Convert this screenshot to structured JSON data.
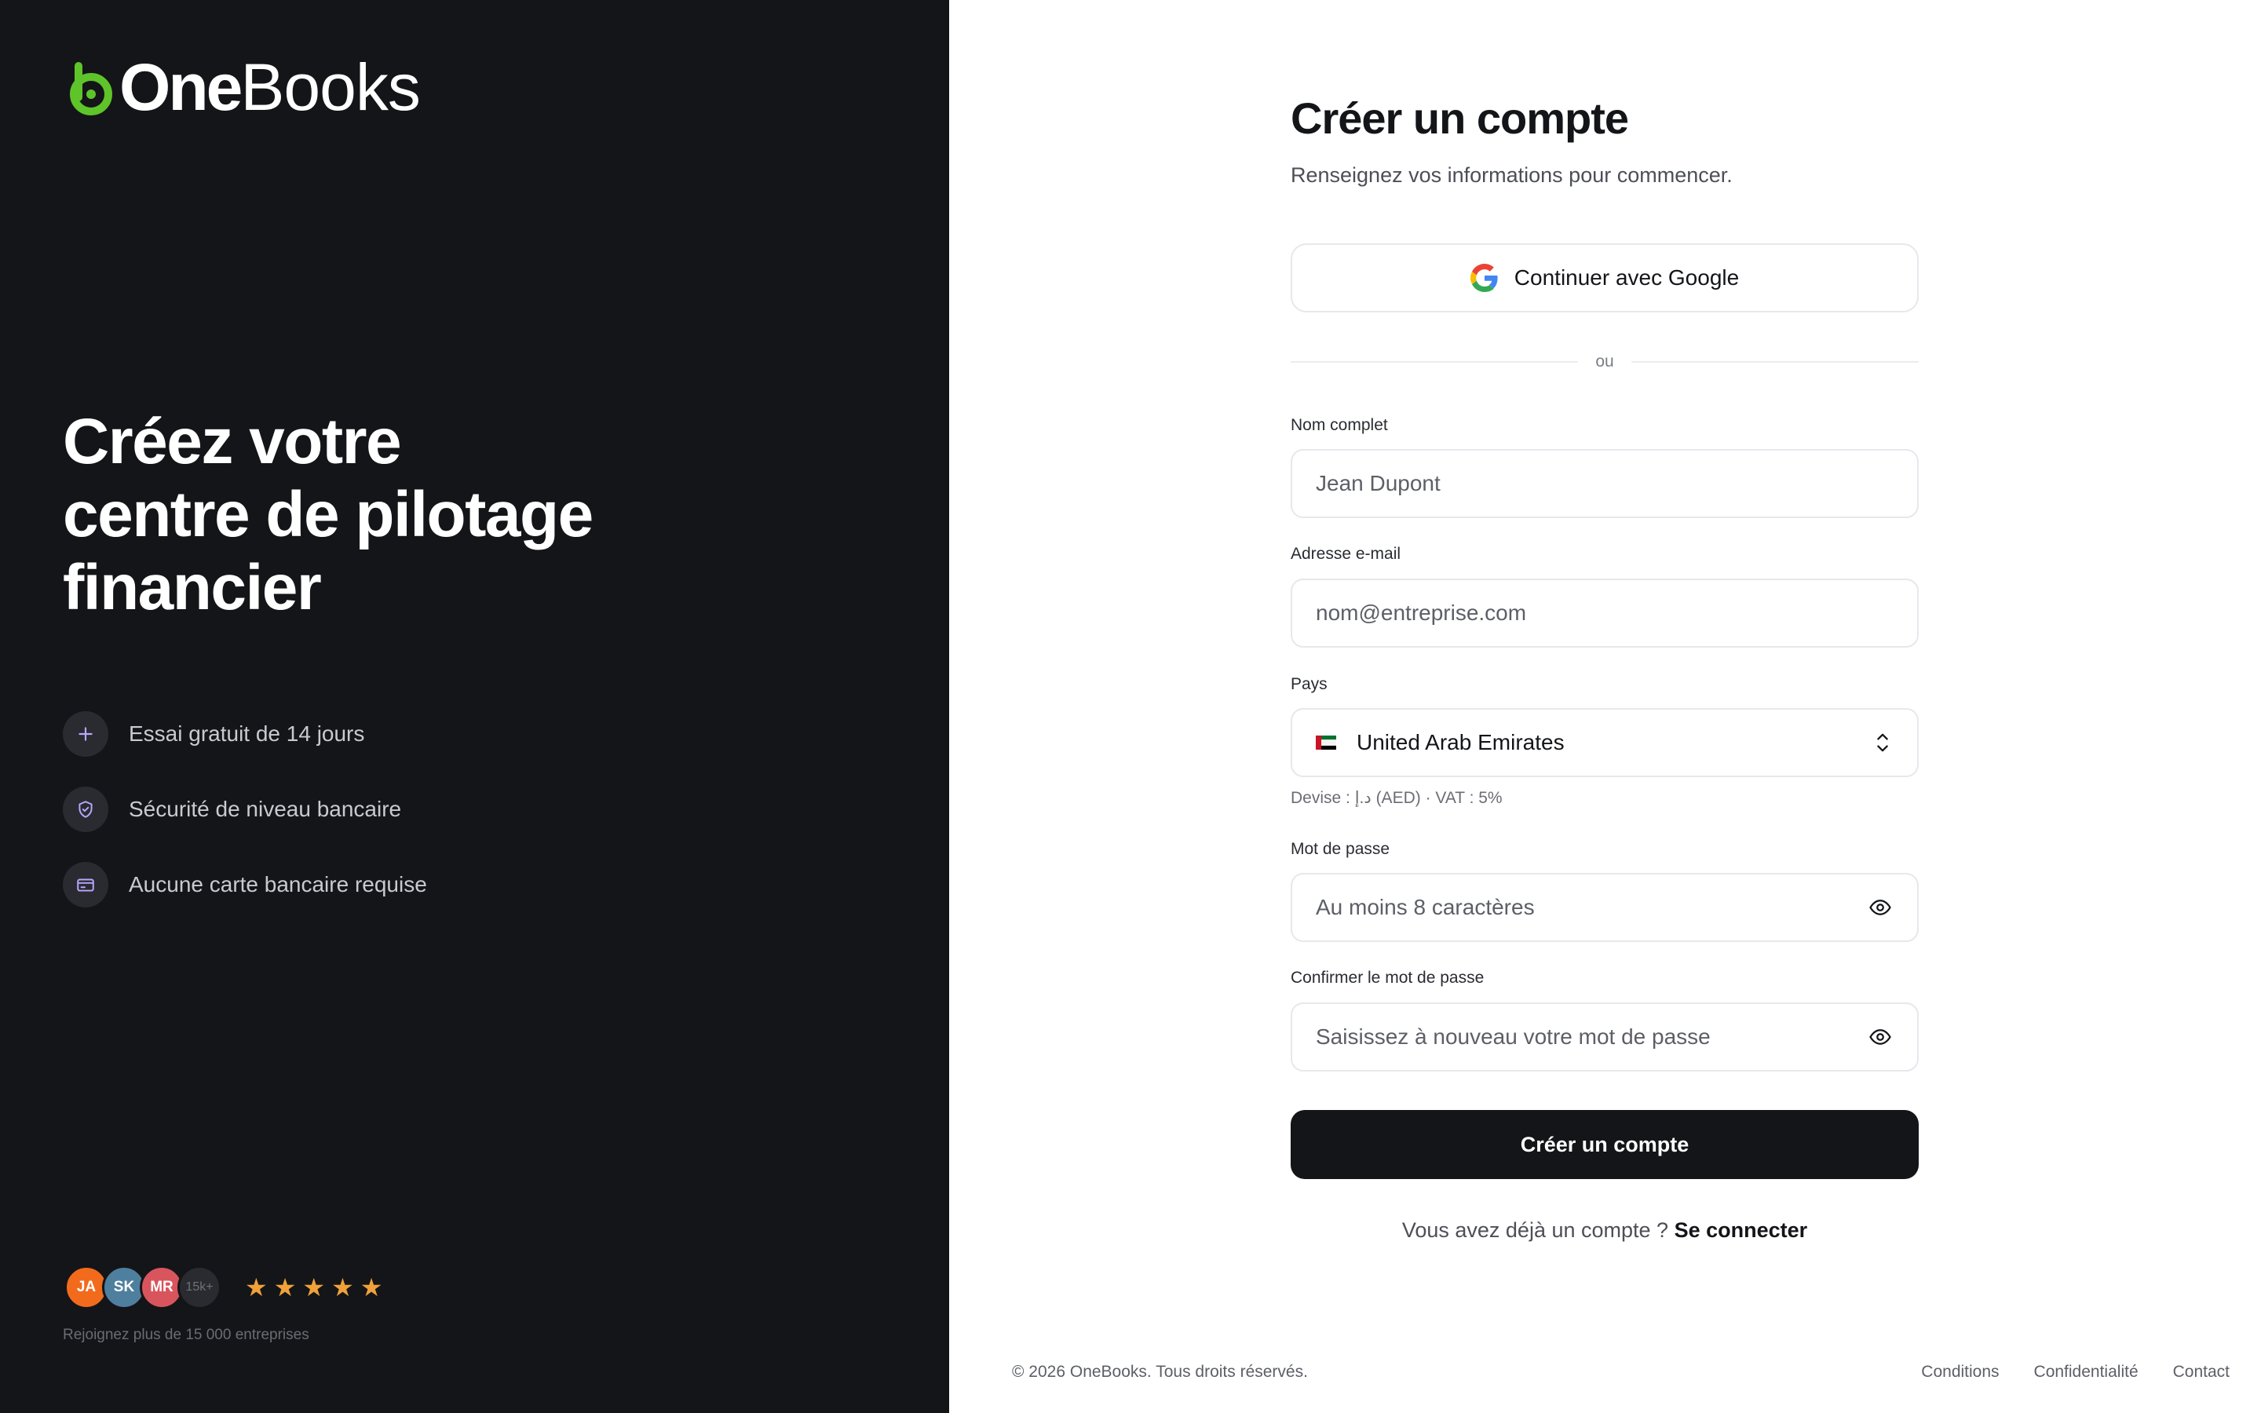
{
  "brand": {
    "name_part1": "One",
    "name_part2": "Books",
    "accent": "#5ec42a",
    "logo_icon": "onebooks-logo-icon"
  },
  "hero": {
    "line1": "Créez votre",
    "line2": "centre de pilotage",
    "line3": "financier"
  },
  "features": [
    {
      "icon": "plus-icon",
      "label": "Essai gratuit de 14 jours"
    },
    {
      "icon": "shield-check-icon",
      "label": "Sécurité de niveau bancaire"
    },
    {
      "icon": "credit-card-icon",
      "label": "Aucune carte bancaire requise"
    }
  ],
  "social": {
    "avatars": [
      {
        "initials": "JA",
        "color": "#f26b1d"
      },
      {
        "initials": "SK",
        "color": "#4f7f9e"
      },
      {
        "initials": "MR",
        "color": "#d9555d"
      },
      {
        "initials": "15k+",
        "color": "#2a2b30"
      }
    ],
    "rating_stars": 5,
    "stars": "★★★★★",
    "caption": "Rejoignez plus de 15 000 entreprises"
  },
  "form": {
    "title": "Créer un compte",
    "subtitle": "Renseignez vos informations pour commencer.",
    "google_label": "Continuer avec Google",
    "divider": "ou",
    "full_name": {
      "label": "Nom complet",
      "placeholder": "Jean Dupont"
    },
    "email": {
      "label": "Adresse e-mail",
      "placeholder": "nom@entreprise.com"
    },
    "country": {
      "label": "Pays",
      "value": "United Arab Emirates",
      "hint": "Devise : د.إ (AED) · VAT : 5%"
    },
    "password": {
      "label": "Mot de passe",
      "placeholder": "Au moins 8 caractères"
    },
    "confirm_password": {
      "label": "Confirmer le mot de passe",
      "placeholder": "Saisissez à nouveau votre mot de passe"
    },
    "submit_label": "Créer un compte",
    "signin_prompt": "Vous avez déjà un compte ?",
    "signin_link": "Se connecter"
  },
  "footer": {
    "copyright": "© 2026 OneBooks. Tous droits réservés.",
    "links": [
      "Conditions",
      "Confidentialité",
      "Contact"
    ]
  },
  "colors": {
    "dark_panel": "#141518",
    "primary_button": "#141518",
    "star": "#f0a13a"
  }
}
